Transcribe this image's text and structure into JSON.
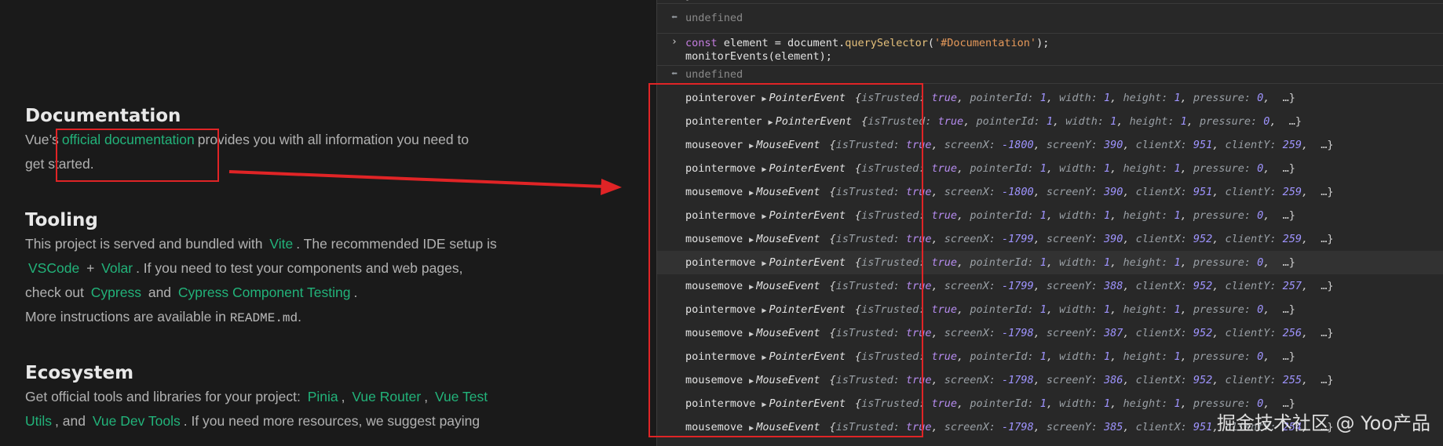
{
  "docs": {
    "documentation": {
      "heading": "Documentation",
      "pre": "Vue’s",
      "link": "official documentation",
      "post": "provides you with all information you need to",
      "line2": "get started."
    },
    "tooling": {
      "heading": "Tooling",
      "t1": "This project is served and bundled with",
      "vite": "Vite",
      "t2": ". The recommended IDE setup is",
      "vscode": "VSCode",
      "plus": "+",
      "volar": "Volar",
      "t3": ". If you need to test your components and web pages,",
      "t4": "check out",
      "cypress": "Cypress",
      "and": "and",
      "cct": "Cypress Component Testing",
      "dot": ".",
      "t5": "More instructions are available in",
      "readme": "README.md",
      "t6": "."
    },
    "ecosystem": {
      "heading": "Ecosystem",
      "t1": "Get official tools and libraries for your project:",
      "pinia": "Pinia",
      "comma1": ",",
      "router": "Vue Router",
      "comma2": ",",
      "vuetest": "Vue Test",
      "utils": "Utils",
      "t2": ", and",
      "devtools": "Vue Dev Tools",
      "t3": ". If you need more resources, we suggest paying"
    }
  },
  "console": {
    "top_fragment": "});",
    "undefined_1": "undefined",
    "input": {
      "kw": "const",
      "var": " element = document.",
      "method": "querySelector",
      "open": "(",
      "arg": "'#Documentation'",
      "close": ");",
      "line2": "monitorEvents(element);"
    },
    "undefined_2": "undefined",
    "events": [
      {
        "name": "pointerover",
        "cls": "PointerEvent",
        "props": [
          [
            "isTrusted",
            "true",
            "b"
          ],
          [
            "pointerId",
            "1",
            "n"
          ],
          [
            "width",
            "1",
            "n"
          ],
          [
            "height",
            "1",
            "n"
          ],
          [
            "pressure",
            "0",
            "n"
          ]
        ]
      },
      {
        "name": "pointerenter",
        "cls": "PointerEvent",
        "props": [
          [
            "isTrusted",
            "true",
            "b"
          ],
          [
            "pointerId",
            "1",
            "n"
          ],
          [
            "width",
            "1",
            "n"
          ],
          [
            "height",
            "1",
            "n"
          ],
          [
            "pressure",
            "0",
            "n"
          ]
        ]
      },
      {
        "name": "mouseover",
        "cls": "MouseEvent",
        "props": [
          [
            "isTrusted",
            "true",
            "b"
          ],
          [
            "screenX",
            "-1800",
            "n"
          ],
          [
            "screenY",
            "390",
            "n"
          ],
          [
            "clientX",
            "951",
            "n"
          ],
          [
            "clientY",
            "259",
            "n"
          ]
        ]
      },
      {
        "name": "pointermove",
        "cls": "PointerEvent",
        "props": [
          [
            "isTrusted",
            "true",
            "b"
          ],
          [
            "pointerId",
            "1",
            "n"
          ],
          [
            "width",
            "1",
            "n"
          ],
          [
            "height",
            "1",
            "n"
          ],
          [
            "pressure",
            "0",
            "n"
          ]
        ]
      },
      {
        "name": "mousemove",
        "cls": "MouseEvent",
        "props": [
          [
            "isTrusted",
            "true",
            "b"
          ],
          [
            "screenX",
            "-1800",
            "n"
          ],
          [
            "screenY",
            "390",
            "n"
          ],
          [
            "clientX",
            "951",
            "n"
          ],
          [
            "clientY",
            "259",
            "n"
          ]
        ]
      },
      {
        "name": "pointermove",
        "cls": "PointerEvent",
        "props": [
          [
            "isTrusted",
            "true",
            "b"
          ],
          [
            "pointerId",
            "1",
            "n"
          ],
          [
            "width",
            "1",
            "n"
          ],
          [
            "height",
            "1",
            "n"
          ],
          [
            "pressure",
            "0",
            "n"
          ]
        ]
      },
      {
        "name": "mousemove",
        "cls": "MouseEvent",
        "props": [
          [
            "isTrusted",
            "true",
            "b"
          ],
          [
            "screenX",
            "-1799",
            "n"
          ],
          [
            "screenY",
            "390",
            "n"
          ],
          [
            "clientX",
            "952",
            "n"
          ],
          [
            "clientY",
            "259",
            "n"
          ]
        ]
      },
      {
        "name": "pointermove",
        "cls": "PointerEvent",
        "props": [
          [
            "isTrusted",
            "true",
            "b"
          ],
          [
            "pointerId",
            "1",
            "n"
          ],
          [
            "width",
            "1",
            "n"
          ],
          [
            "height",
            "1",
            "n"
          ],
          [
            "pressure",
            "0",
            "n"
          ]
        ],
        "highlight": true
      },
      {
        "name": "mousemove",
        "cls": "MouseEvent",
        "props": [
          [
            "isTrusted",
            "true",
            "b"
          ],
          [
            "screenX",
            "-1799",
            "n"
          ],
          [
            "screenY",
            "388",
            "n"
          ],
          [
            "clientX",
            "952",
            "n"
          ],
          [
            "clientY",
            "257",
            "n"
          ]
        ]
      },
      {
        "name": "pointermove",
        "cls": "PointerEvent",
        "props": [
          [
            "isTrusted",
            "true",
            "b"
          ],
          [
            "pointerId",
            "1",
            "n"
          ],
          [
            "width",
            "1",
            "n"
          ],
          [
            "height",
            "1",
            "n"
          ],
          [
            "pressure",
            "0",
            "n"
          ]
        ]
      },
      {
        "name": "mousemove",
        "cls": "MouseEvent",
        "props": [
          [
            "isTrusted",
            "true",
            "b"
          ],
          [
            "screenX",
            "-1798",
            "n"
          ],
          [
            "screenY",
            "387",
            "n"
          ],
          [
            "clientX",
            "952",
            "n"
          ],
          [
            "clientY",
            "256",
            "n"
          ]
        ]
      },
      {
        "name": "pointermove",
        "cls": "PointerEvent",
        "props": [
          [
            "isTrusted",
            "true",
            "b"
          ],
          [
            "pointerId",
            "1",
            "n"
          ],
          [
            "width",
            "1",
            "n"
          ],
          [
            "height",
            "1",
            "n"
          ],
          [
            "pressure",
            "0",
            "n"
          ]
        ]
      },
      {
        "name": "mousemove",
        "cls": "MouseEvent",
        "props": [
          [
            "isTrusted",
            "true",
            "b"
          ],
          [
            "screenX",
            "-1798",
            "n"
          ],
          [
            "screenY",
            "386",
            "n"
          ],
          [
            "clientX",
            "952",
            "n"
          ],
          [
            "clientY",
            "255",
            "n"
          ]
        ]
      },
      {
        "name": "pointermove",
        "cls": "PointerEvent",
        "props": [
          [
            "isTrusted",
            "true",
            "b"
          ],
          [
            "pointerId",
            "1",
            "n"
          ],
          [
            "width",
            "1",
            "n"
          ],
          [
            "height",
            "1",
            "n"
          ],
          [
            "pressure",
            "0",
            "n"
          ]
        ]
      },
      {
        "name": "mousemove",
        "cls": "MouseEvent",
        "props": [
          [
            "isTrusted",
            "true",
            "b"
          ],
          [
            "screenX",
            "-1798",
            "n"
          ],
          [
            "screenY",
            "385",
            "n"
          ],
          [
            "clientX",
            "951",
            "n"
          ],
          [
            "clientY",
            "254",
            "n"
          ]
        ]
      }
    ],
    "ellipsis": "…",
    "result_icon": "return-chevron-icon",
    "prompt_icon": "prompt-chevron-icon"
  },
  "watermark": "掘金技术社区 @ Yoo产品",
  "colors": {
    "link": "#22b37a",
    "annotation_red": "#e02426",
    "console_bg": "#282828",
    "page_bg": "#1a1a1a"
  }
}
